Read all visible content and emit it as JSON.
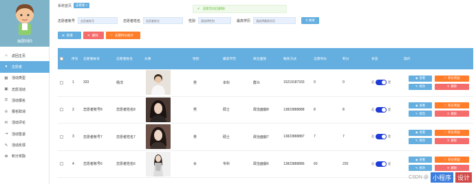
{
  "sidebar": {
    "admin_name": "admin",
    "items": [
      {
        "label": "返回主页",
        "icon": "home-icon",
        "active": false
      },
      {
        "label": "志愿者",
        "icon": "user-icon",
        "active": true
      },
      {
        "label": "活动类型",
        "icon": "grid-icon",
        "active": false
      },
      {
        "label": "志愿活动",
        "icon": "calendar-icon",
        "active": false
      },
      {
        "label": "活动报名",
        "icon": "list-icon",
        "active": false
      },
      {
        "label": "报名取消",
        "icon": "cancel-icon",
        "active": false
      },
      {
        "label": "活动评论",
        "icon": "comment-icon",
        "active": false
      },
      {
        "label": "活动签退",
        "icon": "signout-icon",
        "active": false
      },
      {
        "label": "活动反馈",
        "icon": "feedback-icon",
        "active": false
      },
      {
        "label": "积分奖励",
        "icon": "gift-icon",
        "active": false
      }
    ]
  },
  "breadcrumb": {
    "home": "系统首页",
    "current": "志愿者"
  },
  "toast": {
    "message": "志愿活动已删除!"
  },
  "search": {
    "fields": [
      {
        "label": "志愿者帐号",
        "placeholder": "志愿者帐号"
      },
      {
        "label": "志愿者姓名",
        "placeholder": "志愿者姓名"
      },
      {
        "label": "性别",
        "placeholder": "请选择性别"
      },
      {
        "label": "最高学历",
        "placeholder": "请选择最高学历"
      }
    ],
    "button": "搜索"
  },
  "actions": {
    "add": "新增",
    "delete": "删除",
    "stat": "志愿时长统计"
  },
  "table": {
    "headers": [
      "",
      "序号",
      "志愿者帐号",
      "志愿者姓名",
      "头像",
      "性别",
      "最高学历",
      "政治面貌",
      "联系方式",
      "志愿时长",
      "积分",
      "状态",
      "操作"
    ],
    "op_labels": {
      "view": "查看",
      "score": "积分奖励",
      "edit": "修改",
      "remove": "删除"
    },
    "toggle_labels": {
      "off": "否",
      "on": "是"
    },
    "rows": [
      {
        "index": "1",
        "account": "333",
        "name": "杨洋",
        "gender": "男",
        "edu": "本科",
        "politics": "群众",
        "phone": "15219187333",
        "hours": "0",
        "points": "0"
      },
      {
        "index": "2",
        "account": "志愿者帐号8",
        "name": "志愿者姓名8",
        "gender": "男",
        "edu": "硕士",
        "politics": "政治面貌8",
        "phone": "13823888888",
        "hours": "8",
        "points": "8"
      },
      {
        "index": "3",
        "account": "志愿者帐号7",
        "name": "志愿者姓名7",
        "gender": "男",
        "edu": "硕士",
        "politics": "政治面貌7",
        "phone": "13823888887",
        "hours": "7",
        "points": "7"
      },
      {
        "index": "4",
        "account": "志愿者帐号6",
        "name": "志愿者姓名6",
        "gender": "女",
        "edu": "专科",
        "politics": "政治面貌6",
        "phone": "13823888886",
        "hours": "60",
        "points": "220"
      }
    ]
  },
  "watermark": {
    "left": "CSDN @",
    "mid": "小程序",
    "right": "设计"
  },
  "colors": {
    "accent": "#64aee0",
    "danger": "#f56c6c",
    "orange": "#ff7d2a",
    "toggle": "#1e3cd7"
  }
}
